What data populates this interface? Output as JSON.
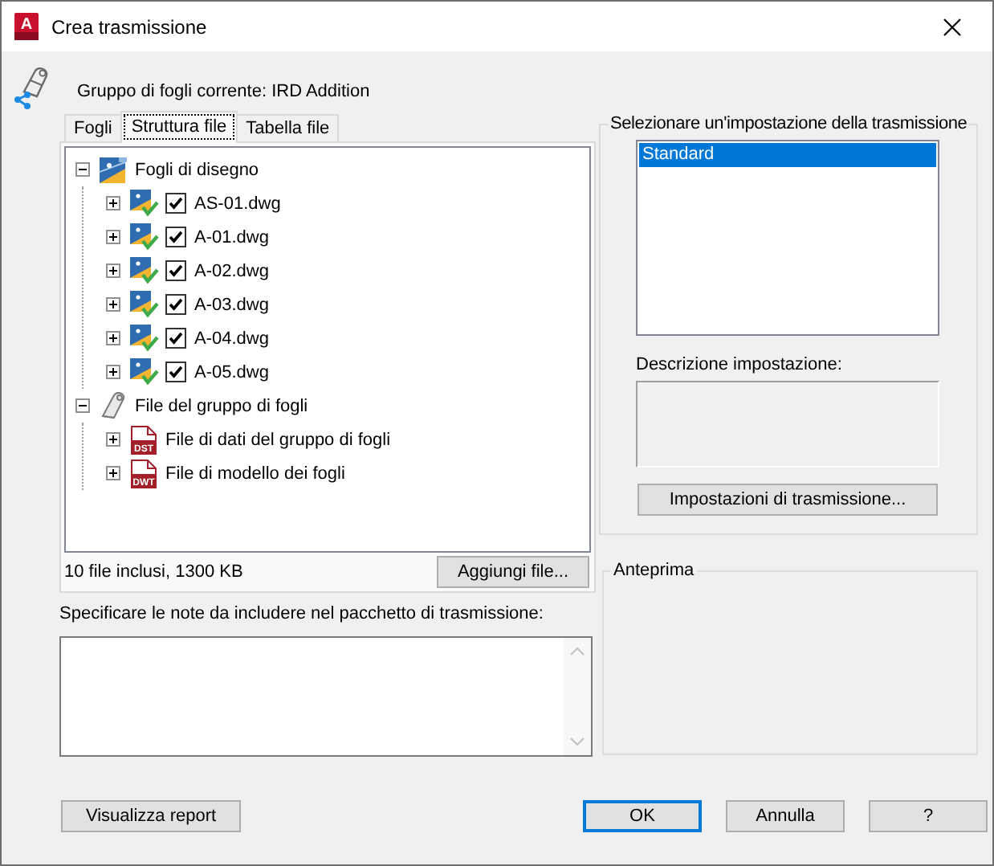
{
  "window": {
    "title": "Crea trasmissione",
    "app_icon_letter": "A"
  },
  "sheet_set": {
    "label": "Gruppo di fogli corrente: IRD Addition"
  },
  "tabs": [
    {
      "label": "Fogli",
      "selected": false
    },
    {
      "label": "Struttura file",
      "selected": true
    },
    {
      "label": "Tabella file",
      "selected": false
    }
  ],
  "tree": [
    {
      "label": "Fogli di disegno",
      "kind": "sheets",
      "expanded": true,
      "children": [
        {
          "label": "AS-01.dwg",
          "kind": "drawing",
          "expanded": false,
          "checked": true
        },
        {
          "label": "A-01.dwg",
          "kind": "drawing",
          "expanded": false,
          "checked": true
        },
        {
          "label": "A-02.dwg",
          "kind": "drawing",
          "expanded": false,
          "checked": true
        },
        {
          "label": "A-03.dwg",
          "kind": "drawing",
          "expanded": false,
          "checked": true
        },
        {
          "label": "A-04.dwg",
          "kind": "drawing",
          "expanded": false,
          "checked": true
        },
        {
          "label": "A-05.dwg",
          "kind": "drawing",
          "expanded": false,
          "checked": true
        }
      ]
    },
    {
      "label": "File del gruppo di fogli",
      "kind": "sheetset",
      "expanded": true,
      "children": [
        {
          "label": "File di dati del gruppo di fogli",
          "kind": "file",
          "file_type": "DST",
          "expanded": false
        },
        {
          "label": "File di modello dei fogli",
          "kind": "file",
          "file_type": "DWT",
          "expanded": false
        }
      ]
    }
  ],
  "file_summary": "10 file inclusi, 1300 KB",
  "add_button": "Aggiungi file...",
  "notes": {
    "label": "Specificare le note da includere nel pacchetto di trasmissione:"
  },
  "setup_group": {
    "title": "Selezionare un'impostazione della trasmissione",
    "items": [
      {
        "label": "Standard",
        "selected": true
      }
    ],
    "description_label": "Descrizione impostazione:",
    "button": "Impostazioni di trasmissione..."
  },
  "preview": {
    "title": "Anteprima"
  },
  "buttons": [
    {
      "label": "Visualizza report",
      "default": false
    },
    {
      "label": "OK",
      "default": true
    },
    {
      "label": "Annulla",
      "default": false
    },
    {
      "label": "?",
      "default": false
    }
  ]
}
